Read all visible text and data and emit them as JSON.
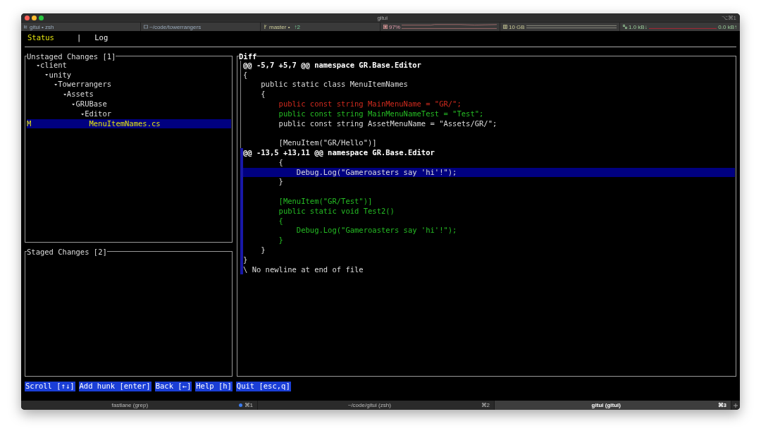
{
  "window": {
    "title": "gitui",
    "shortcut": "⌥⌘1"
  },
  "status_strip": [
    {
      "kind": "session",
      "text": "gitui • zsh"
    },
    {
      "kind": "path",
      "text": "~/code/towerrangers"
    },
    {
      "kind": "branch",
      "text": "master •",
      "extra": "↑2"
    },
    {
      "kind": "cpu",
      "text": "97%"
    },
    {
      "kind": "memory",
      "text": "10 GB"
    },
    {
      "kind": "network",
      "text": "1.0 kB↓",
      "extra": "0.0 kB↑"
    }
  ],
  "app_tabs": [
    {
      "label": "Status",
      "selected": true
    },
    {
      "label": "Log",
      "selected": false
    }
  ],
  "tab_separator": "|",
  "unstaged": {
    "title": "Unstaged Changes [1]",
    "tree": [
      {
        "label": "client",
        "expanded": true,
        "children": [
          {
            "label": "unity",
            "expanded": true,
            "children": [
              {
                "label": "Towerrangers",
                "expanded": true,
                "children": [
                  {
                    "label": "Assets",
                    "expanded": true,
                    "children": [
                      {
                        "label": "GRUBase",
                        "expanded": true,
                        "children": [
                          {
                            "label": "Editor",
                            "expanded": true,
                            "children": [
                              {
                                "status": "M",
                                "label": "MenuItemNames.cs",
                                "selected": true
                              }
                            ]
                          }
                        ]
                      }
                    ]
                  }
                ]
              }
            ]
          }
        ]
      }
    ]
  },
  "staged": {
    "title": "Staged Changes [2]"
  },
  "diff": {
    "title": "Diff",
    "hunks": [
      {
        "selected": false,
        "lines": [
          {
            "kind": "header",
            "text": "@@ -5,7 +5,7 @@ namespace GR.Base.Editor",
            "selected": false
          },
          {
            "kind": "context",
            "text": "{",
            "selected": false
          },
          {
            "kind": "context",
            "text": "    public static class MenuItemNames",
            "selected": false
          },
          {
            "kind": "context",
            "text": "    {",
            "selected": false
          },
          {
            "kind": "delete",
            "text": "        public const string MainMenuName = \"GR/\";",
            "selected": false
          },
          {
            "kind": "add",
            "text": "        public const string MainMenuNameTest = \"Test\";",
            "selected": false
          },
          {
            "kind": "context",
            "text": "        public const string AssetMenuName = \"Assets/GR/\";",
            "selected": false
          },
          {
            "kind": "blank"
          },
          {
            "kind": "context",
            "text": "        [MenuItem(\"GR/Hello\")]",
            "selected": false
          }
        ]
      },
      {
        "selected": true,
        "lines": [
          {
            "kind": "header",
            "text": "@@ -13,5 +13,11 @@ namespace GR.Base.Editor",
            "selected": false
          },
          {
            "kind": "context",
            "text": "        {",
            "selected": false
          },
          {
            "kind": "context",
            "text": "            Debug.Log(\"Gameroasters say 'hi'!\");",
            "selected": true
          },
          {
            "kind": "context",
            "text": "        }",
            "selected": false
          },
          {
            "kind": "blank"
          },
          {
            "kind": "add",
            "text": "        [MenuItem(\"GR/Test\")]",
            "selected": false
          },
          {
            "kind": "add",
            "text": "        public static void Test2()",
            "selected": false
          },
          {
            "kind": "add",
            "text": "        {",
            "selected": false
          },
          {
            "kind": "add",
            "text": "            Debug.Log(\"Gameroasters say 'hi'!\");",
            "selected": false
          },
          {
            "kind": "add",
            "text": "        }",
            "selected": false
          },
          {
            "kind": "context",
            "text": "    }",
            "selected": false
          },
          {
            "kind": "context",
            "text": "}",
            "selected": false
          },
          {
            "kind": "context",
            "text": "\\ No newline at end of file",
            "selected": false
          }
        ]
      }
    ]
  },
  "key_hints": [
    "Scroll [↑↓]",
    "Add hunk [enter]",
    "Back [←]",
    "Help [h]",
    "Quit [esc,q]"
  ],
  "terminal_tabs": [
    {
      "label": "fastlane (grep)",
      "shortcut": "⌘1",
      "selected": false,
      "activity": true
    },
    {
      "label": "~/code/gitui (zsh)",
      "shortcut": "⌘2",
      "selected": false,
      "activity": false
    },
    {
      "label": "gitui (gitui)",
      "shortcut": "⌘3",
      "selected": true,
      "activity": false
    }
  ]
}
